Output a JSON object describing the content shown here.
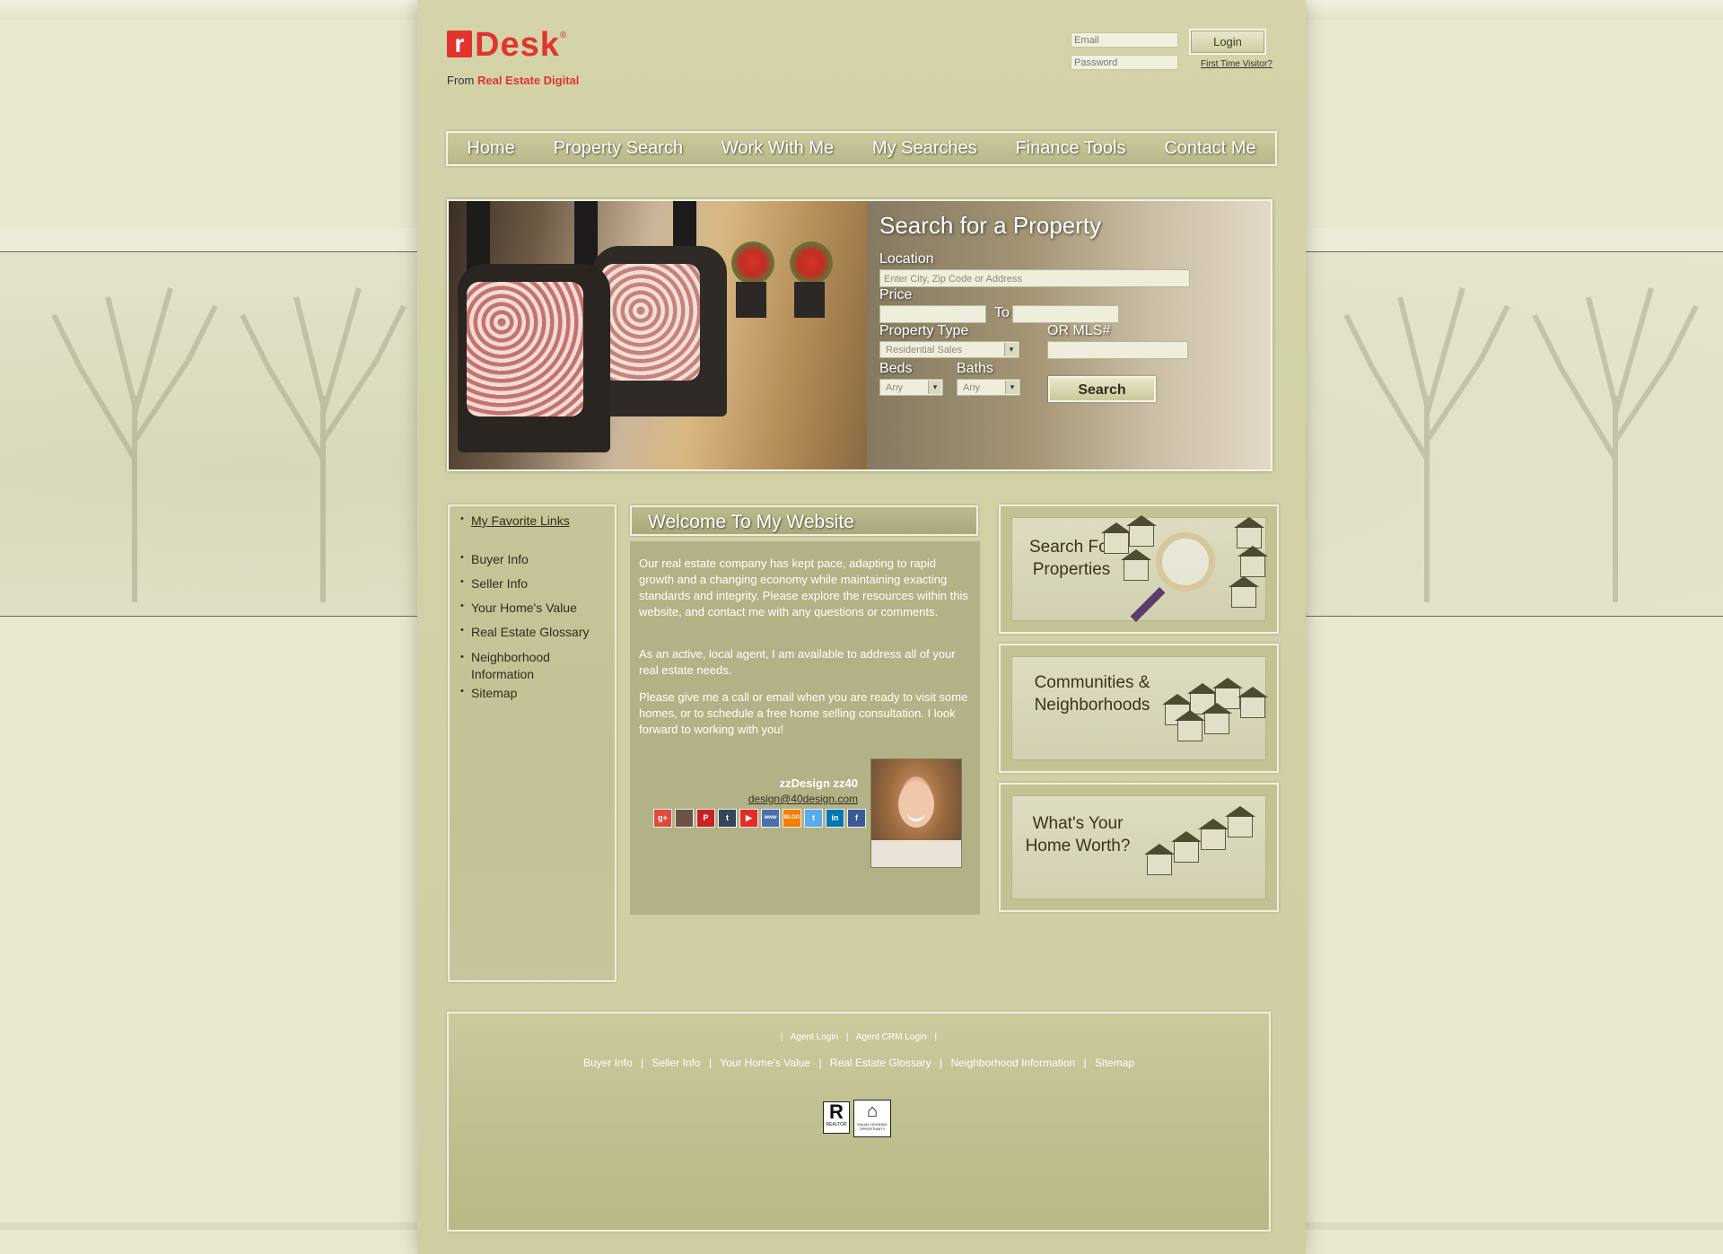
{
  "brand": {
    "logo_mark": "r",
    "logo_name": "Desk",
    "logo_reg": "®",
    "from_text": "From",
    "company": "Real Estate Digital"
  },
  "login": {
    "email_placeholder": "Email",
    "password_placeholder": "Password",
    "login_label": "Login",
    "first_time": "First Time Visitor?"
  },
  "nav": {
    "items": [
      "Home",
      "Property Search",
      "Work With Me",
      "My Searches",
      "Finance Tools",
      "Contact Me"
    ]
  },
  "search": {
    "title": "Search for a Property",
    "location_label": "Location",
    "location_placeholder": "Enter City, Zip Code or Address",
    "price_label": "Price",
    "to_label": "To",
    "property_type_label": "Property Type",
    "property_type_value": "Residential Sales",
    "mls_label": "OR MLS#",
    "beds_label": "Beds",
    "beds_value": "Any",
    "baths_label": "Baths",
    "baths_value": "Any",
    "search_button": "Search"
  },
  "sidebar": {
    "favorite": "My Favorite Links",
    "items": [
      "Buyer Info",
      "Seller Info",
      "Your Home's Value",
      "Real Estate Glossary",
      "Neighborhood Information",
      "Sitemap"
    ]
  },
  "welcome": {
    "title": "Welcome To My Website",
    "p1": "Our real estate company has kept pace, adapting to rapid growth and a changing economy while maintaining exacting standards and integrity. Please explore the resources within this website, and contact me with any questions or comments.",
    "p2": "As an active, local agent, I am available to address all of your real estate needs.",
    "p3": "Please give me a call or email when you are ready to visit some homes, or to schedule a free home selling consultation. I look forward to working with you!",
    "agent_name": "zzDesign zz40",
    "agent_email": "design@40design.com",
    "socials": [
      "google-plus",
      "instagram",
      "pinterest",
      "tumblr",
      "youtube",
      "www",
      "blog",
      "twitter",
      "linkedin",
      "facebook"
    ],
    "social_labels": [
      "g+",
      "",
      "P",
      "t",
      "▶",
      "www",
      "BLOG",
      "t",
      "in",
      "f"
    ],
    "social_colors": [
      "#dd4b39",
      "#6b5444",
      "#cb2027",
      "#35465c",
      "#e52d27",
      "#4a6fb0",
      "#f57d00",
      "#55acee",
      "#0077b5",
      "#3b5998"
    ]
  },
  "panels": {
    "search_props": "Search For Properties",
    "communities": "Communities & Neighborhoods",
    "home_worth": "What's Your Home Worth?"
  },
  "footer": {
    "row1": [
      "Agent Login",
      "Agent CRM Login"
    ],
    "row2": [
      "Buyer Info",
      "Seller Info",
      "Your Home's Value",
      "Real Estate Glossary",
      "Neighborhood Information",
      "Sitemap"
    ],
    "realtor_text": "REALTOR",
    "eho_text": "EQUAL HOUSING OPPORTUNITY"
  }
}
